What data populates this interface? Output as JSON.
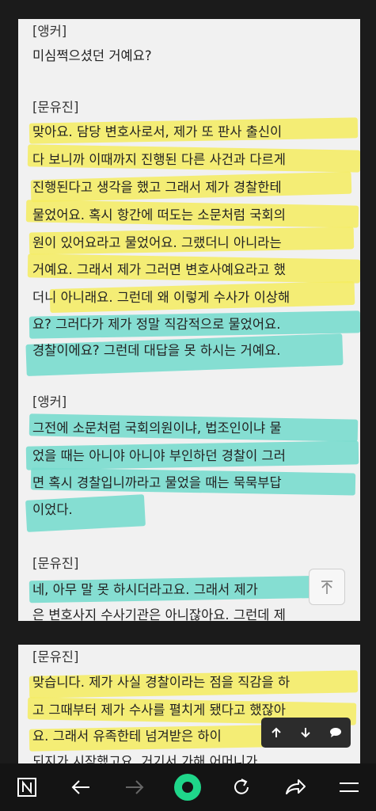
{
  "card1": {
    "lines": [
      "[앵커]",
      "미심쩍으셨던 거예요?",
      "[문유진]",
      "맞아요. 담당 변호사로서, 제가 또 판사 출신이",
      "다 보니까 이때까지 진행된 다른 사건과 다르게",
      "진행된다고 생각을 했고 그래서 제가 경찰한테",
      "물었어요. 혹시 항간에 떠도는 소문처럼 국회의",
      "원이 있어요라고 물었어요. 그랬더니 아니라는",
      "거예요. 그래서 제가 그러면 변호사예요라고 했",
      "더니 아니래요. 그런데 왜 이렇게 수사가 이상해",
      "요? 그러다가 제가 정말 직감적으로 물었어요.",
      "경찰이에요? 그런데 대답을 못 하시는 거예요.",
      "[앵커]",
      "그전에 소문처럼 국회의원이냐, 법조인이냐 물",
      "었을 때는 아니야 아니야 부인하던 경찰이 그러",
      "면 혹시 경찰입니까라고 물었을 때는 묵묵부답",
      "이었다.",
      "[문유진]",
      "네, 아무 말 못 하시더라고요. 그래서 제가 ",
      "은 변호사지 수사기관은 아니잖아요. 그런데 제"
    ]
  },
  "card2": {
    "lines": [
      "[문유진]",
      "맞습니다. 제가 사실 경찰이라는 점을 직감을 하",
      "고 그때부터 제가 수사를 펼치게 됐다고 했잖아",
      "요. 그래서 유족한테 넘겨받은 하이",
      "되지가 시작했고요. 거기서 가해 어머니가"
    ]
  },
  "buttons": {
    "to_top": "scroll-to-top",
    "mini": [
      "arrow-up-icon",
      "arrow-down-icon",
      "comment-icon"
    ],
    "nav": [
      "notes-icon",
      "back-icon",
      "forward-icon",
      "record-icon",
      "refresh-icon",
      "share-icon",
      "menu-icon"
    ]
  },
  "colors": {
    "yellow": "#f5ec5f",
    "cyan": "#79dcce",
    "record": "#1fd68a"
  }
}
